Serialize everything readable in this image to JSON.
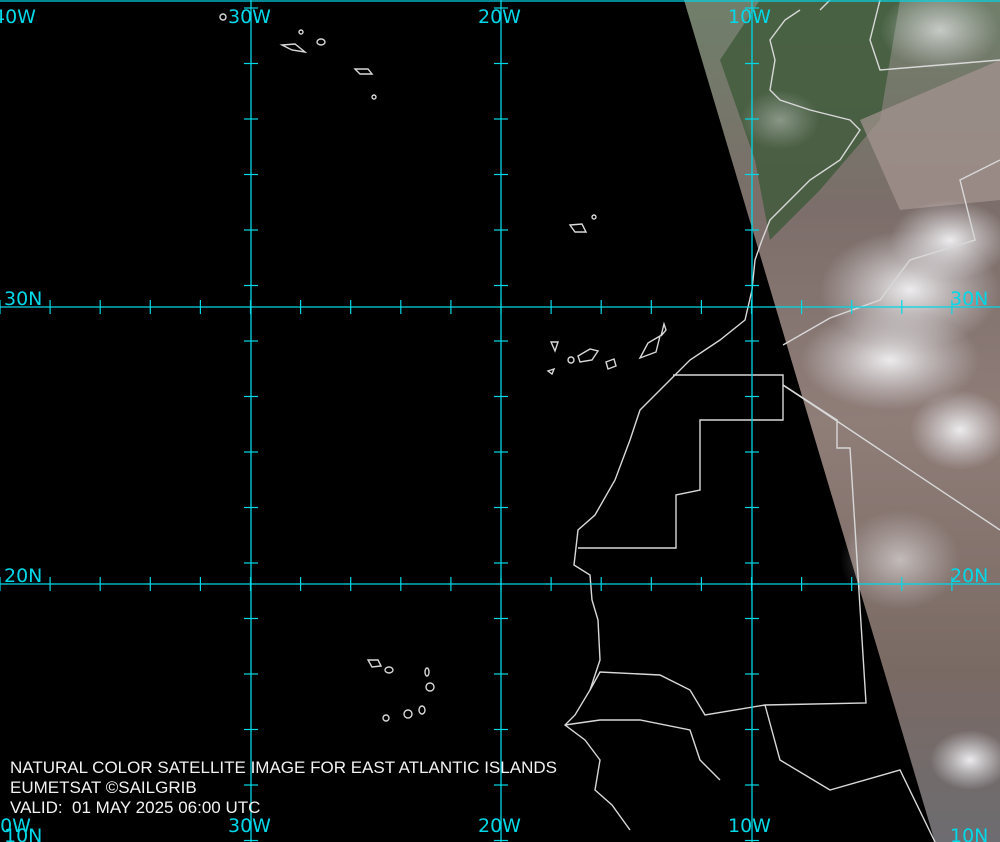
{
  "map": {
    "caption": {
      "title": "NATURAL COLOR SATELLITE IMAGE FOR EAST ATLANTIC ISLANDS",
      "credit": "EUMETSAT ©SAILGRIB",
      "valid": "VALID:  01 MAY 2025 06:00 UTC"
    },
    "longitude_labels": [
      "40W",
      "30W",
      "20W",
      "10W"
    ],
    "latitude_labels": [
      "30N",
      "20N",
      "10N"
    ],
    "colors": {
      "grid": "#00d8e8",
      "background": "#000000",
      "coastline": "#d8d8d8",
      "caption_text": "#f2f2f2"
    },
    "features": [
      "Azores",
      "Madeira",
      "Canary Islands",
      "Cape Verde",
      "Western Sahara",
      "Mauritania",
      "Senegal",
      "Morocco"
    ]
  }
}
